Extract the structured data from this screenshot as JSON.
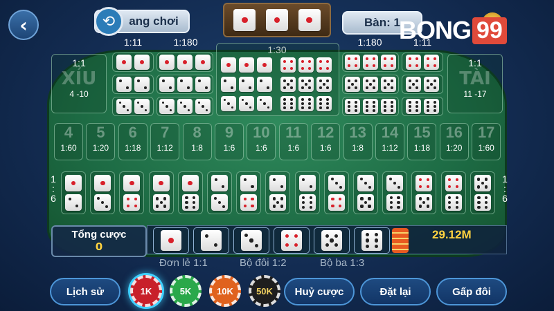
{
  "top": {
    "back_icon": "chevron-left-icon",
    "history_label": "ang chơi",
    "history_icon": "history-clock-icon",
    "table_label": "Bàn: 1",
    "result_dice": [
      1,
      1,
      1
    ]
  },
  "logo": {
    "text": "BONG",
    "num": "99"
  },
  "board": {
    "xiu": {
      "odds": "1:1",
      "name": "XỈU",
      "range": "4 -10"
    },
    "tai": {
      "odds": "1:1",
      "name": "TÀI",
      "range": "11 -17"
    },
    "pair_odds_left": "1:11",
    "pair_odds_right": "1:11",
    "triple_odds_left": "1:180",
    "triple_odds_right": "1:180",
    "any_triple_odds": "1:30",
    "totals": [
      {
        "n": "4",
        "o": "1:60"
      },
      {
        "n": "5",
        "o": "1:20"
      },
      {
        "n": "6",
        "o": "1:18"
      },
      {
        "n": "7",
        "o": "1:12"
      },
      {
        "n": "8",
        "o": "1:8"
      },
      {
        "n": "9",
        "o": "1:6"
      },
      {
        "n": "10",
        "o": "1:6"
      },
      {
        "n": "11",
        "o": "1:6"
      },
      {
        "n": "12",
        "o": "1:6"
      },
      {
        "n": "13",
        "o": "1:8"
      },
      {
        "n": "14",
        "o": "1:12"
      },
      {
        "n": "15",
        "o": "1:18"
      },
      {
        "n": "16",
        "o": "1:20"
      },
      {
        "n": "17",
        "o": "1:60"
      }
    ],
    "combo_odds_left": [
      "1",
      ":",
      "6"
    ],
    "combo_odds_right": [
      "1",
      ":",
      "6"
    ],
    "combos": [
      [
        1,
        2
      ],
      [
        1,
        3
      ],
      [
        1,
        4
      ],
      [
        1,
        5
      ],
      [
        1,
        6
      ],
      [
        2,
        3
      ],
      [
        2,
        4
      ],
      [
        2,
        5
      ],
      [
        2,
        6
      ],
      [
        3,
        4
      ],
      [
        3,
        5
      ],
      [
        3,
        6
      ],
      [
        4,
        5
      ],
      [
        4,
        6
      ],
      [
        5,
        6
      ]
    ]
  },
  "bet": {
    "total_label": "Tổng cược",
    "total_value": "0",
    "single_dice": [
      1,
      2,
      3,
      4,
      5,
      6
    ],
    "balance": "29.12M",
    "chip_stack_icon": "chip-stack-icon"
  },
  "payouts": {
    "single": "Đơn lẻ 1:1",
    "pair": "Bộ đôi 1:2",
    "triple": "Bộ ba 1:3"
  },
  "controls": {
    "history": "Lịch sử",
    "cancel": "Huỷ cược",
    "reset": "Đặt lại",
    "double": "Gấp đôi",
    "chips": [
      {
        "label": "1K",
        "color": "#c8202a",
        "selected": true
      },
      {
        "label": "5K",
        "color": "#2aa84a",
        "selected": false
      },
      {
        "label": "10K",
        "color": "#e0621e",
        "selected": false
      },
      {
        "label": "50K",
        "color": "#1e1e1e",
        "selected": false
      }
    ]
  }
}
